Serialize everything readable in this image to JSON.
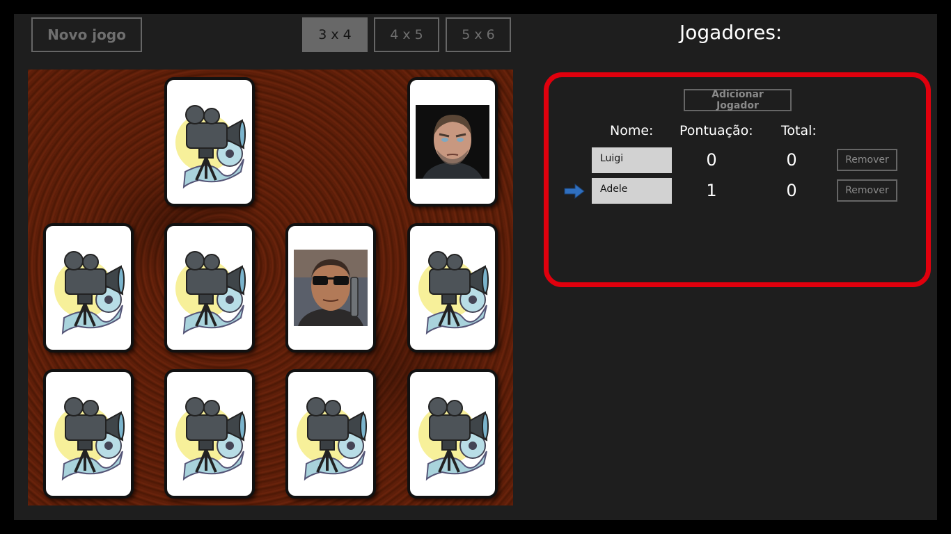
{
  "toolbar": {
    "new_game_label": "Novo jogo",
    "sizes": [
      "3 x 4",
      "4 x 5",
      "5 x 6"
    ],
    "active_size": "3 x 4"
  },
  "players_title": "Jogadores:",
  "board": {
    "grid": "3 x 4",
    "cards": [
      {
        "row": 1,
        "col": 1,
        "state": "matched"
      },
      {
        "row": 1,
        "col": 2,
        "state": "face-down",
        "icon": "movie-camera-icon"
      },
      {
        "row": 1,
        "col": 3,
        "state": "matched"
      },
      {
        "row": 1,
        "col": 4,
        "state": "face-up",
        "icon": "portrait-man-stubble-icon"
      },
      {
        "row": 2,
        "col": 1,
        "state": "face-down",
        "icon": "movie-camera-icon"
      },
      {
        "row": 2,
        "col": 2,
        "state": "face-down",
        "icon": "movie-camera-icon"
      },
      {
        "row": 2,
        "col": 3,
        "state": "face-up",
        "icon": "portrait-man-sunglasses-icon"
      },
      {
        "row": 2,
        "col": 4,
        "state": "face-down",
        "icon": "movie-camera-icon"
      },
      {
        "row": 3,
        "col": 1,
        "state": "face-down",
        "icon": "movie-camera-icon"
      },
      {
        "row": 3,
        "col": 2,
        "state": "face-down",
        "icon": "movie-camera-icon"
      },
      {
        "row": 3,
        "col": 3,
        "state": "face-down",
        "icon": "movie-camera-icon"
      },
      {
        "row": 3,
        "col": 4,
        "state": "face-down",
        "icon": "movie-camera-icon"
      }
    ]
  },
  "players_panel": {
    "add_player_label": "Adicionar Jogador",
    "headers": {
      "name": "Nome:",
      "score": "Pontuação:",
      "total": "Total:"
    },
    "players": [
      {
        "name": "Luigi",
        "score": "0",
        "total": "0",
        "current": false
      },
      {
        "name": "Adele",
        "score": "1",
        "total": "0",
        "current": true
      }
    ],
    "remove_label": "Remover",
    "current_turn_icon": "arrow-right-icon",
    "border_color": "#e0000d"
  },
  "colors": {
    "active_button_bg": "#686868",
    "board_wood": "#5c1d09",
    "arrow": "#2f6fbf"
  }
}
